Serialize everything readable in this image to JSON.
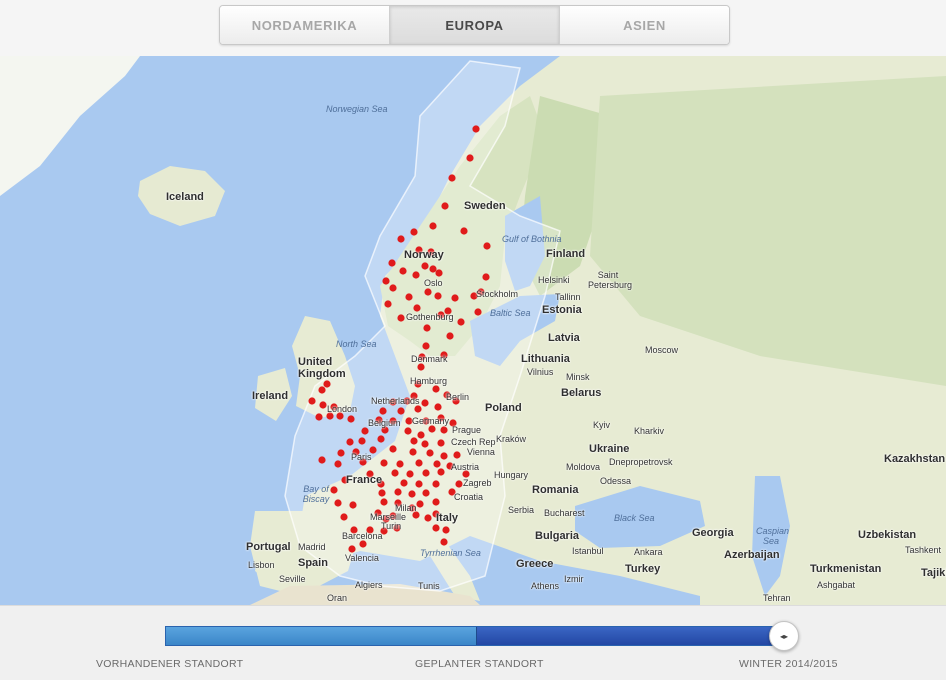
{
  "tabs": [
    {
      "label": "NORDAMERIKA",
      "active": false
    },
    {
      "label": "EUROPA",
      "active": true
    },
    {
      "label": "ASIEN",
      "active": false
    }
  ],
  "map": {
    "labels": {
      "norwegian_sea": "Norwegian Sea",
      "iceland": "Iceland",
      "sweden": "Sweden",
      "gulf_of_bothnia": "Gulf of Bothnia",
      "finland": "Finland",
      "norway": "Norway",
      "helsinki": "Helsinki",
      "saint_petersburg": "Saint Petersburg",
      "oslo": "Oslo",
      "stockholm": "Stockholm",
      "tallinn": "Tallinn",
      "estonia": "Estonia",
      "baltic_sea": "Baltic Sea",
      "gothenburg": "Gothenburg",
      "latvia": "Latvia",
      "north_sea": "North Sea",
      "denmark": "Denmark",
      "lithuania": "Lithuania",
      "moscow": "Moscow",
      "united_kingdom": "United Kingdom",
      "vilnius": "Vilnius",
      "minsk": "Minsk",
      "hamburg": "Hamburg",
      "ireland": "Ireland",
      "belarus": "Belarus",
      "netherlands": "Netherlands",
      "berlin": "Berlin",
      "london": "London",
      "poland": "Poland",
      "germany": "Germany",
      "belgium": "Belgium",
      "kyiv": "Kyiv",
      "prague": "Prague",
      "kharkiv": "Kharkiv",
      "czech_rep": "Czech Rep",
      "krakow": "Kraków",
      "ukraine": "Ukraine",
      "paris": "Paris",
      "vienna": "Vienna",
      "dnepropetrovsk": "Dnepropetrovsk",
      "kazakhstan": "Kazakhstan",
      "moldova": "Moldova",
      "austria": "Austria",
      "hungary": "Hungary",
      "france": "France",
      "bay_of_biscay": "Bay of Biscay",
      "zagreb": "Zagreb",
      "odessa": "Odessa",
      "romania": "Romania",
      "croatia": "Croatia",
      "serbia": "Serbia",
      "bucharest": "Bucharest",
      "milan": "Milan",
      "turin": "Turin",
      "black_sea": "Black Sea",
      "marseille": "Marseille",
      "italy": "Italy",
      "caspian_sea": "Caspian Sea",
      "uzbekistan": "Uzbekistan",
      "portugal": "Portugal",
      "madrid": "Madrid",
      "barcelona": "Barcelona",
      "bulgaria": "Bulgaria",
      "georgia": "Georgia",
      "tyrrhenian_sea": "Tyrrhenian Sea",
      "istanbul": "Istanbul",
      "ankara": "Ankara",
      "azerbaijan": "Azerbaijan",
      "lisbon": "Lisbon",
      "spain": "Spain",
      "valencia": "Valencia",
      "greece": "Greece",
      "turkey": "Turkey",
      "tashkent": "Tashkent",
      "turkmenistan": "Turkmenistan",
      "tajikistan": "Tajiki",
      "seville": "Seville",
      "algiers": "Algiers",
      "tunis": "Tunis",
      "athens": "Athens",
      "izmir": "Izmir",
      "tehran": "Tehran",
      "ashgabat": "Ashgabat",
      "oran": "Oran"
    }
  },
  "legend": {
    "existing": "VORHANDENER STANDORT",
    "planned": "GEPLANTER STANDORT",
    "timeline": "WINTER 2014/2015"
  },
  "colors": {
    "charger_dot": "#e01b1b",
    "coverage_area": "#ffffff",
    "water": "#a9c9f0",
    "land": "#e8ecd6",
    "slider_existing": "#3b86c8",
    "slider_planned": "#2347a4"
  },
  "icons": {
    "slider_handle": "arrows-horizontal-icon"
  }
}
